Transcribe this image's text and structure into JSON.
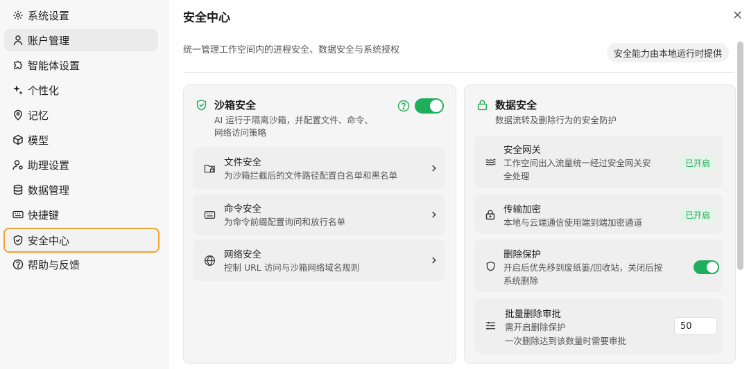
{
  "sidebar": {
    "items": [
      {
        "label": "系统设置",
        "icon": "gear-icon"
      },
      {
        "label": "账户管理",
        "icon": "user-icon"
      },
      {
        "label": "智能体设置",
        "icon": "puzzle-icon"
      },
      {
        "label": "个性化",
        "icon": "sparkle-icon"
      },
      {
        "label": "记忆",
        "icon": "location-pin-icon"
      },
      {
        "label": "模型",
        "icon": "cube-icon"
      },
      {
        "label": "助理设置",
        "icon": "user-settings-icon"
      },
      {
        "label": "数据管理",
        "icon": "database-icon"
      },
      {
        "label": "快捷键",
        "icon": "keyboard-icon"
      },
      {
        "label": "安全中心",
        "icon": "shield-icon"
      },
      {
        "label": "帮助与反馈",
        "icon": "help-icon"
      }
    ],
    "active_index": 9
  },
  "header": {
    "title": "安全中心",
    "subtitle": "统一管理工作空间内的进程安全、数据安全与系统授权",
    "badge": "安全能力由本地运行时提供"
  },
  "sandbox": {
    "title": "沙箱安全",
    "desc_line1": "AI 运行于隔离沙箱，并配置文件、命令、",
    "desc_line2": "网络访问策略",
    "enabled": true,
    "rows": [
      {
        "title": "文件安全",
        "desc": "为沙箱拦截后的文件路径配置白名单和黑名单",
        "icon": "folder-lock-icon"
      },
      {
        "title": "命令安全",
        "desc": "为命令前缀配置询问和放行名单",
        "icon": "keyboard-icon"
      },
      {
        "title": "网络安全",
        "desc": "控制 URL 访问与沙箱网络域名规则",
        "icon": "globe-icon"
      }
    ]
  },
  "data_security": {
    "title": "数据安全",
    "desc": "数据流转及删除行为的安全防护",
    "gateway": {
      "title": "安全网关",
      "desc_line1": "工作空间出入流量统一经过安全网关安",
      "desc_line2": "全处理",
      "badge": "已开启"
    },
    "encryption": {
      "title": "传输加密",
      "desc": "本地与云端通信使用端到端加密通道",
      "badge": "已开启"
    },
    "delete_protection": {
      "title": "删除保护",
      "desc_line1": "开启后优先移到废纸篓/回收站，关闭后按",
      "desc_line2": "系统删除",
      "enabled": true
    },
    "batch_approval": {
      "title": "批量删除审批",
      "desc_line1": "需开启删除保护",
      "desc_line2": "一次删除达到该数量时需要审批",
      "value": "50"
    }
  },
  "colors": {
    "accent_green": "#1fae5b",
    "active_outline": "#f0a432",
    "enabled_badge_text": "#2aa55a"
  }
}
